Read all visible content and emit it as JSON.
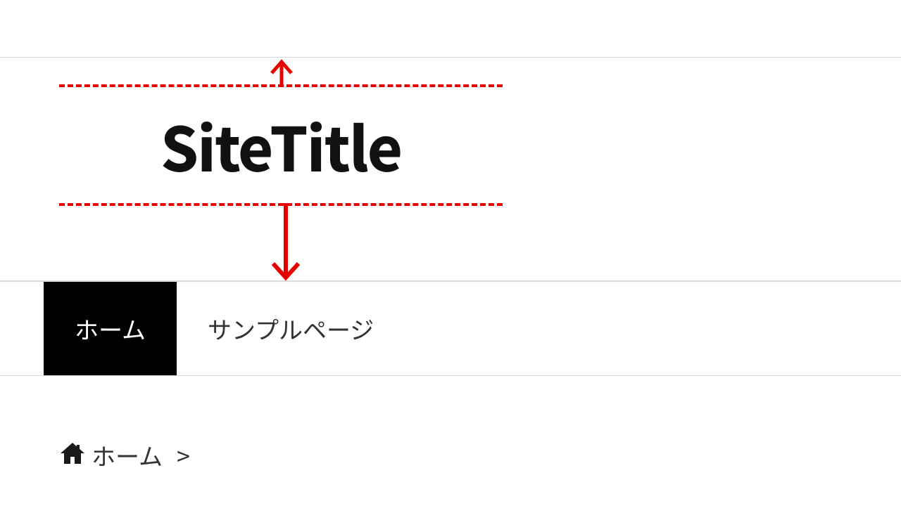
{
  "header": {
    "site_title": "SiteTitle"
  },
  "nav": {
    "items": [
      {
        "label": "ホーム",
        "active": true
      },
      {
        "label": "サンプルページ",
        "active": false
      }
    ]
  },
  "breadcrumb": {
    "home_label": "ホーム",
    "separator": ">"
  },
  "annotation": {
    "type": "margin-indicator",
    "arrows": [
      "up",
      "down"
    ],
    "dash_color": "#e60000"
  }
}
